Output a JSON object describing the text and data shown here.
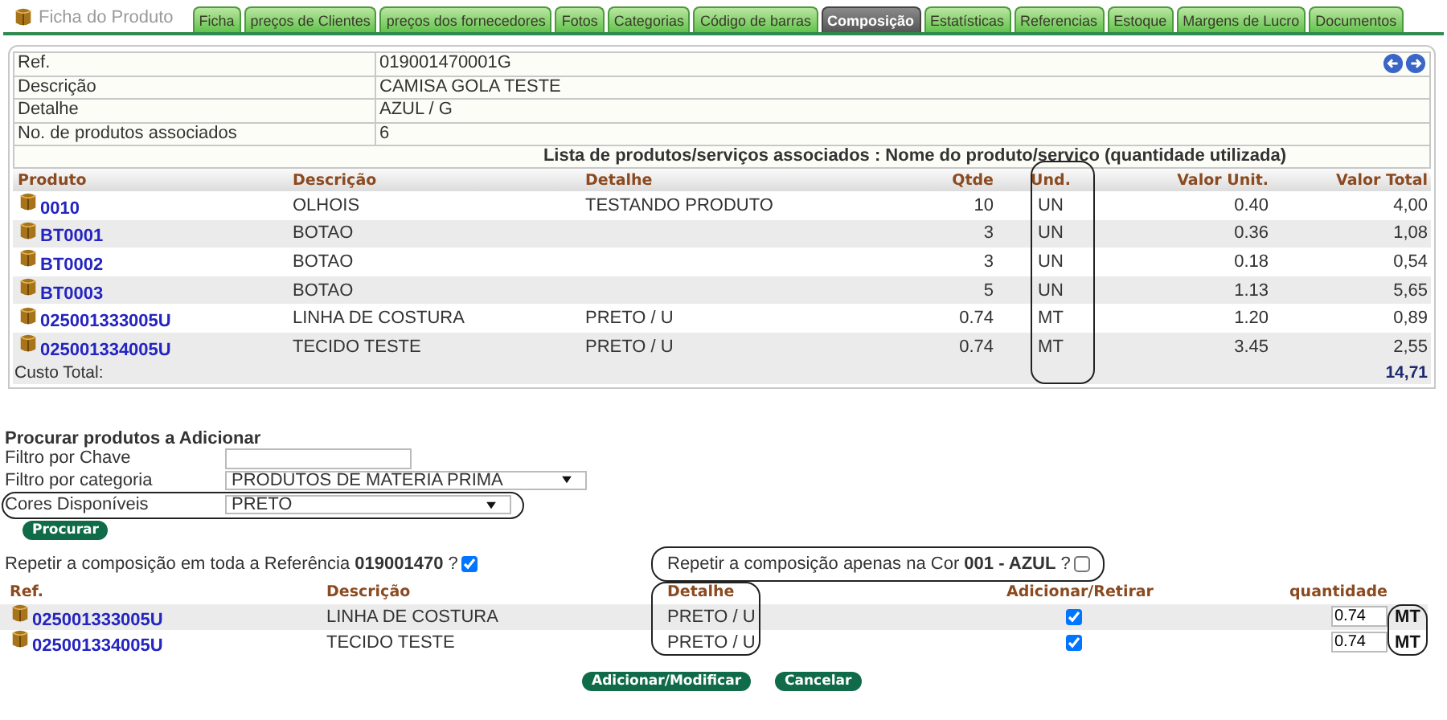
{
  "header": {
    "title": "Ficha do Produto"
  },
  "tabs": [
    {
      "label": "Ficha",
      "selected": false
    },
    {
      "label": "preços de Clientes",
      "selected": false
    },
    {
      "label": "preços dos fornecedores",
      "selected": false
    },
    {
      "label": "Fotos",
      "selected": false
    },
    {
      "label": "Categorias",
      "selected": false
    },
    {
      "label": "Código de barras",
      "selected": false
    },
    {
      "label": "Composição",
      "selected": true
    },
    {
      "label": "Estatísticas",
      "selected": false
    },
    {
      "label": "Referencias",
      "selected": false
    },
    {
      "label": "Estoque",
      "selected": false
    },
    {
      "label": "Margens de Lucro",
      "selected": false
    },
    {
      "label": "Documentos",
      "selected": false
    }
  ],
  "product_info": [
    {
      "label": "Ref.",
      "value": "019001470001G"
    },
    {
      "label": "Descrição",
      "value": "CAMISA GOLA TESTE"
    },
    {
      "label": "Detalhe",
      "value": "AZUL / G"
    },
    {
      "label": "No. de produtos associados",
      "value": "6"
    }
  ],
  "list_heading": "Lista de produtos/serviços associados : Nome do produto/servico (quantidade utilizada)",
  "table": {
    "columns": [
      "Produto",
      "Descrição",
      "Detalhe",
      "Qtde",
      "Und.",
      "Valor Unit.",
      "Valor Total"
    ],
    "rows": [
      {
        "produto": "0010",
        "descricao": "OLHOIS",
        "detalhe": "TESTANDO PRODUTO",
        "qtde": "10",
        "und": "UN",
        "valor_unit": "0.40",
        "valor_total": "4,00"
      },
      {
        "produto": "BT0001",
        "descricao": "BOTAO",
        "qtde": "3",
        "und": "UN",
        "valor_unit": "0.36",
        "valor_total": "1,08"
      },
      {
        "produto": "BT0002",
        "descricao": "BOTAO",
        "qtde": "3",
        "und": "UN",
        "valor_unit": "0.18",
        "valor_total": "0,54"
      },
      {
        "produto": "BT0003",
        "descricao": "BOTAO",
        "qtde": "5",
        "und": "UN",
        "valor_unit": "1.13",
        "valor_total": "5,65"
      },
      {
        "produto": "025001333005U",
        "descricao": "LINHA DE COSTURA",
        "detalhe": "PRETO / U",
        "qtde": "0.74",
        "und": "MT",
        "valor_unit": "1.20",
        "valor_total": "0,89"
      },
      {
        "produto": "025001334005U",
        "descricao": "TECIDO TESTE",
        "detalhe": "PRETO / U",
        "qtde": "0.74",
        "und": "MT",
        "valor_unit": "3.45",
        "valor_total": "2,55"
      }
    ],
    "total": {
      "label": "Custo Total:",
      "value": "14,71"
    }
  },
  "search": {
    "title": "Procurar produtos a Adicionar",
    "fields": [
      {
        "kind": "input",
        "label": "Filtro por Chave"
      },
      {
        "kind": "select",
        "label": "Filtro por categoria",
        "value": "PRODUTOS DE MATERIA PRIMA"
      },
      {
        "kind": "select",
        "label": "Cores Disponíveis",
        "value": "PRETO"
      }
    ],
    "button": "Procurar"
  },
  "repeat_reference": {
    "text": "Repetir a composição em toda a Referência **019001470** ?",
    "checked": true
  },
  "repeat_color": {
    "text": "Repetir a composição apenas na Cor **001 - AZUL** ?",
    "checked": false
  },
  "add_table": {
    "columns": [
      "Ref.",
      "Descrição",
      "Detalhe",
      "Adicionar/Retirar",
      "quantidade"
    ],
    "rows": [
      {
        "ref": "025001333005U",
        "descricao": "LINHA DE COSTURA",
        "detalhe": "PRETO / U",
        "checked": true,
        "quantidade": "0.74",
        "unit": "MT"
      },
      {
        "ref": "025001334005U",
        "descricao": "TECIDO TESTE",
        "detalhe": "PRETO / U",
        "checked": true,
        "quantidade": "0.74",
        "unit": "MT"
      }
    ]
  },
  "buttons": [
    "Adicionar/Modificar",
    "Cancelar"
  ]
}
